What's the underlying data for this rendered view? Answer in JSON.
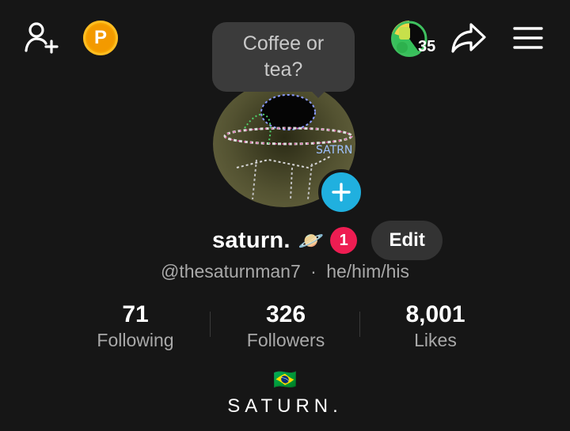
{
  "tooltip": {
    "text": "Coffee or tea?"
  },
  "header": {
    "coin_letter": "P",
    "story_count": "35"
  },
  "profile": {
    "display_name": "saturn.",
    "emoji": "🪐",
    "notification_count": "1",
    "edit_label": "Edit",
    "handle": "@thesaturnman7",
    "pronouns": "he/him/his",
    "separator": "·"
  },
  "stats": [
    {
      "value": "71",
      "label": "Following"
    },
    {
      "value": "326",
      "label": "Followers"
    },
    {
      "value": "8,001",
      "label": "Likes"
    }
  ],
  "bio": {
    "flag": "🇧🇷",
    "text": "SATURN."
  },
  "colors": {
    "background": "#161616",
    "accent_blue": "#20b0df",
    "badge_red": "#ee1d52",
    "coin_orange": "#f5a300",
    "secondary_text": "#a9a9a9"
  }
}
